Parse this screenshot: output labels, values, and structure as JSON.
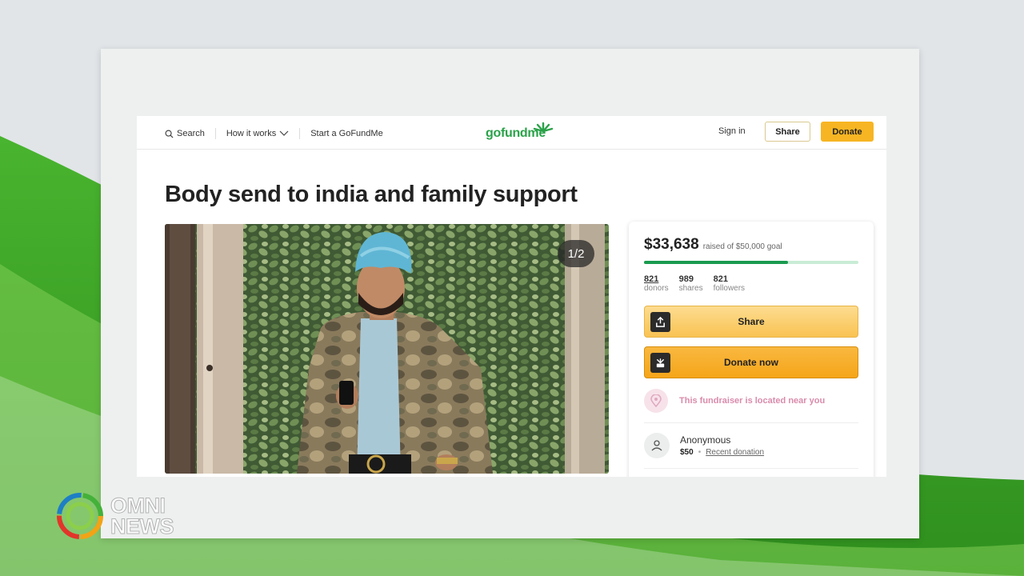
{
  "header": {
    "search_label": "Search",
    "how_it_works_label": "How it works",
    "start_label": "Start a GoFundMe",
    "logo_text": "gofundme",
    "signin_label": "Sign in",
    "share_label": "Share",
    "donate_label": "Donate"
  },
  "campaign": {
    "title": "Body send to india and family support",
    "photo_counter": "1/2"
  },
  "card": {
    "raised_amount": "$33,638",
    "goal_text": "raised of $50,000 goal",
    "progress_fraction": 0.67,
    "stats": [
      {
        "num": "821",
        "label": "donors"
      },
      {
        "num": "989",
        "label": "shares"
      },
      {
        "num": "821",
        "label": "followers"
      }
    ],
    "share_button": "Share",
    "donate_button": "Donate now",
    "near_text": "This fundraiser is located near you",
    "donor_name": "Anonymous",
    "donor_amount": "$50",
    "donor_dot": "•",
    "donor_recent": "Recent donation"
  },
  "broadcast": {
    "logo_line1": "OMNI",
    "logo_line2": "NEWS"
  },
  "colors": {
    "brand_green": "#2aa249",
    "donate_orange": "#f5a519",
    "share_yellow": "#f9c352"
  }
}
